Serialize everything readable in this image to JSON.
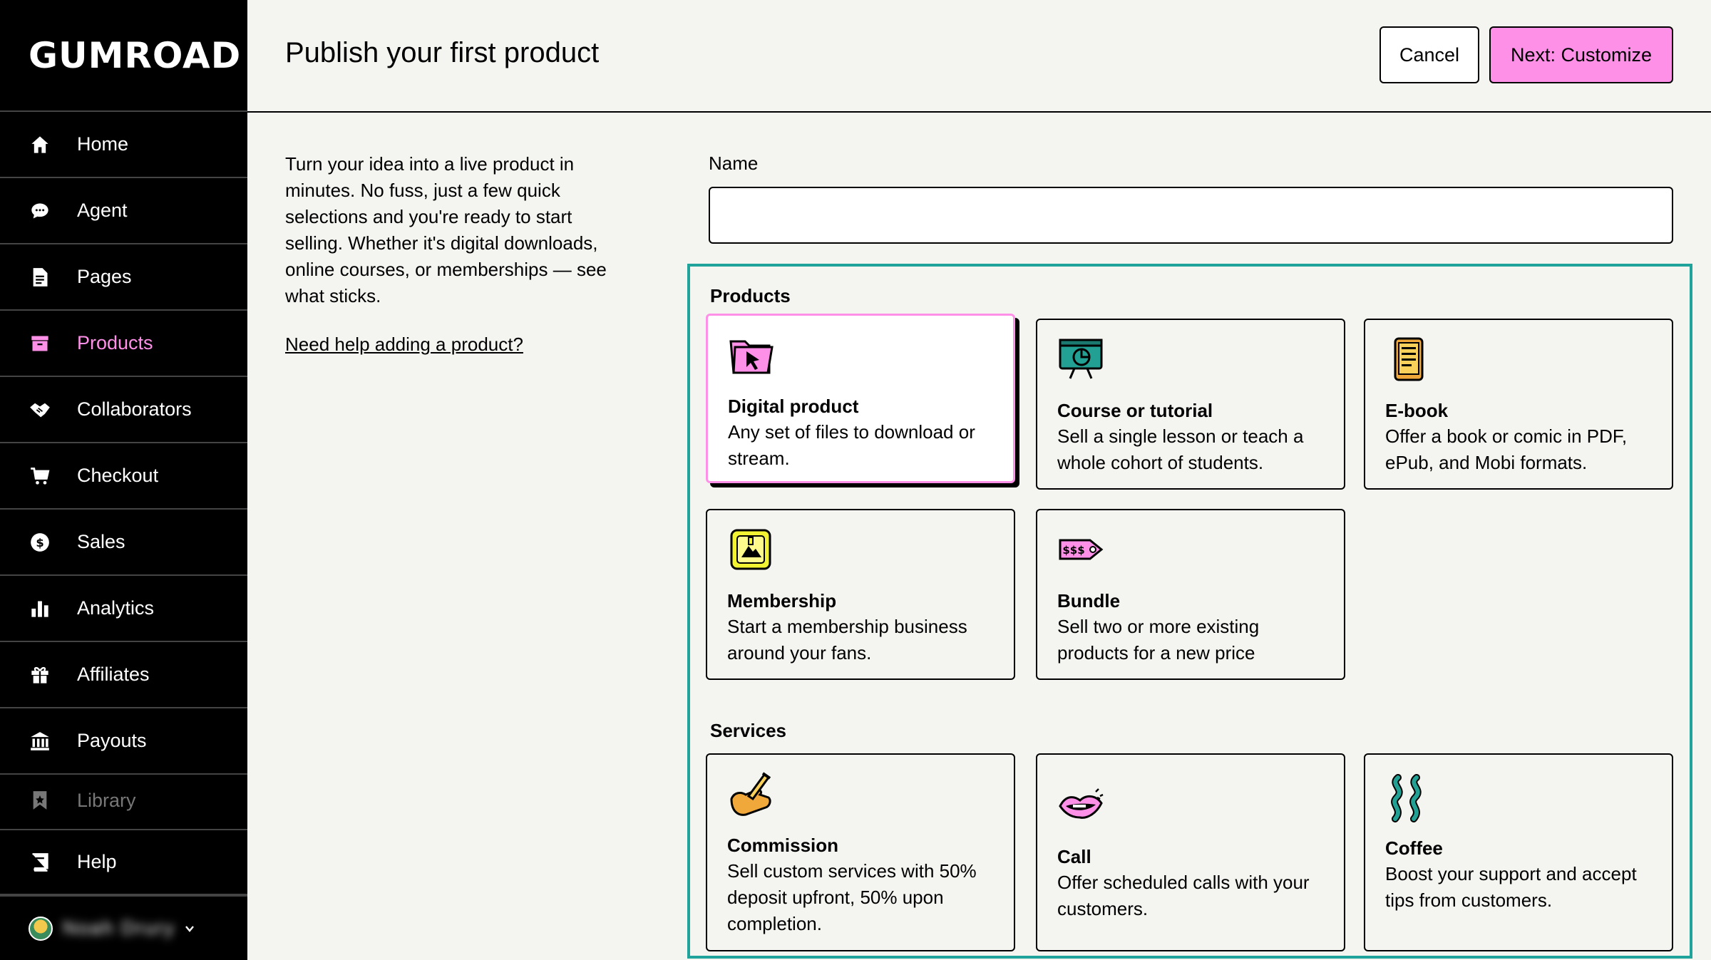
{
  "app": {
    "logo": "GUMROAD"
  },
  "sidebar": {
    "items": [
      {
        "label": "Home",
        "icon": "home-icon"
      },
      {
        "label": "Agent",
        "icon": "chat-icon"
      },
      {
        "label": "Pages",
        "icon": "document-icon"
      },
      {
        "label": "Products",
        "icon": "archive-icon"
      },
      {
        "label": "Collaborators",
        "icon": "handshake-icon"
      },
      {
        "label": "Checkout",
        "icon": "cart-icon"
      },
      {
        "label": "Sales",
        "icon": "dollar-circle-icon"
      },
      {
        "label": "Analytics",
        "icon": "bar-chart-icon"
      },
      {
        "label": "Affiliates",
        "icon": "gift-icon"
      },
      {
        "label": "Payouts",
        "icon": "bank-icon"
      },
      {
        "label": "Library",
        "icon": "bookmark-icon"
      }
    ],
    "help": {
      "label": "Help",
      "icon": "book-icon"
    },
    "user": {
      "name": "Noah Drury"
    },
    "active_color": "#ff90e8"
  },
  "header": {
    "title": "Publish your first product",
    "cancel_label": "Cancel",
    "next_label": "Next: Customize"
  },
  "intro": {
    "text": "Turn your idea into a live product in minutes. No fuss, just a few quick selections and you're ready to start selling. Whether it's digital downloads, online courses, or memberships — see what sticks.",
    "help_link": "Need help adding a product?"
  },
  "form": {
    "name_label": "Name",
    "name_value": "",
    "products_label": "Products",
    "services_label": "Services",
    "products": [
      {
        "title": "Digital product",
        "desc": "Any set of files to download or stream.",
        "icon": "folder-cursor-icon",
        "selected": true
      },
      {
        "title": "Course or tutorial",
        "desc": "Sell a single lesson or teach a whole cohort of students.",
        "icon": "presentation-board-icon"
      },
      {
        "title": "E-book",
        "desc": "Offer a book or comic in PDF, ePub, and Mobi formats.",
        "icon": "ebook-icon"
      },
      {
        "title": "Membership",
        "desc": "Start a membership business around your fans.",
        "icon": "membership-card-icon"
      },
      {
        "title": "Bundle",
        "desc": "Sell two or more existing products for a new price",
        "icon": "price-tag-icon"
      }
    ],
    "services": [
      {
        "title": "Commission",
        "desc": "Sell custom services with 50% deposit upfront, 50% upon completion.",
        "icon": "hand-pen-icon"
      },
      {
        "title": "Call",
        "desc": "Offer scheduled calls with your customers.",
        "icon": "lips-icon"
      },
      {
        "title": "Coffee",
        "desc": "Boost your support and accept tips from customers.",
        "icon": "steam-icon"
      }
    ]
  },
  "colors": {
    "accent": "#ff90e8",
    "panel_border": "#1fa39a",
    "sidebar_bg": "#000000",
    "page_bg": "#f4f4f0"
  }
}
